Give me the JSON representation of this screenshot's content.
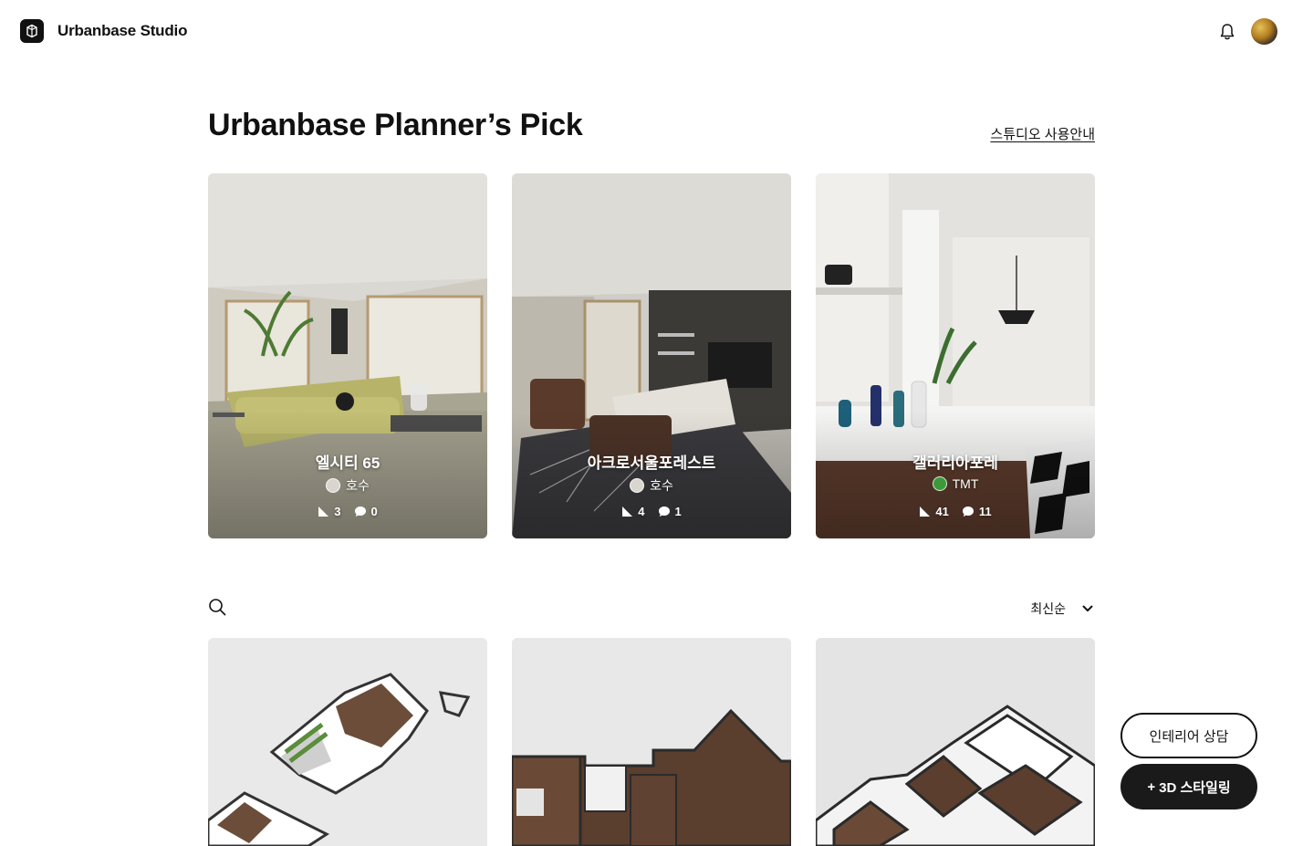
{
  "header": {
    "brand": "Urbanbase Studio",
    "logo_icon": "urbanbase-logo-icon",
    "notification_icon": "bell-icon",
    "avatar_icon": "user-avatar"
  },
  "picks": {
    "title": "Urbanbase Planner’s Pick",
    "guide_link": "스튜디오 사용안내",
    "cards": [
      {
        "name": "엘시티 65",
        "author": "호수",
        "likes": "3",
        "comments": "0"
      },
      {
        "name": "아크로서울포레스트",
        "author": "호수",
        "likes": "4",
        "comments": "1"
      },
      {
        "name": "갤러리아포레",
        "author": "TMT",
        "likes": "41",
        "comments": "11"
      }
    ]
  },
  "list": {
    "search_icon": "search-icon",
    "sort_label": "최신순",
    "sort_icon": "chevron-down-icon"
  },
  "floating": {
    "consult_label": "인테리어 상담",
    "styling_plus": "+",
    "styling_label": "3D 스타일링"
  }
}
